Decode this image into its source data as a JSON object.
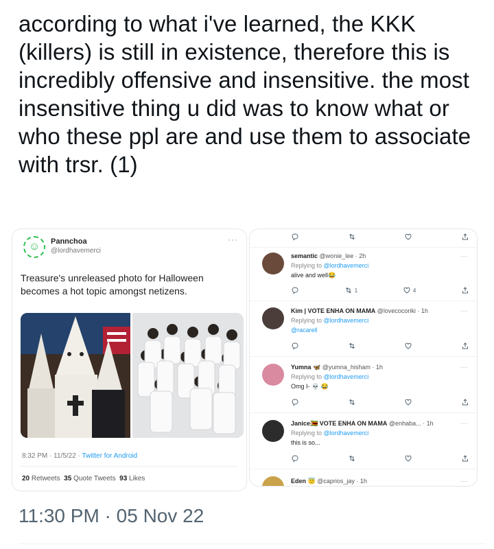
{
  "tweet": {
    "text": "according to what i've learned, the KKK (killers) is still in existence, therefore this is incredibly offensive and insensitive. the most insensitive thing u did was to know what or who these ppl are and use them to associate with trsr. (1)",
    "timestamp": "11:30 PM · 05 Nov 22"
  },
  "left_card": {
    "name": "Pannchoa",
    "handle": "@lordhavemerci",
    "more": "···",
    "text": "Treasure's unreleased photo for Halloween becomes a hot topic amongst netizens.",
    "meta_time": "8:32 PM · 11/5/22 · ",
    "meta_source": "Twitter for Android",
    "retweets_count": "20",
    "retweets_label": " Retweets",
    "quotes_count": "35",
    "quotes_label": " Quote Tweets",
    "likes_count": "93",
    "likes_label": " Likes"
  },
  "right_card": {
    "top_actions": {
      "retweets": "",
      "likes": ""
    },
    "replies": [
      {
        "name": "semantic",
        "handle": "@wonie_lee · 2h",
        "replying_prefix": "Replying to ",
        "replying_to": "@lordhavemerci",
        "body": "alive and well😂",
        "retweets": "1",
        "likes": "4",
        "more": "···"
      },
      {
        "name": "Kim | VOTE ENHA ON MAMA",
        "handle": "@lovecocoriki · 1h",
        "replying_prefix": "Replying to ",
        "replying_to": "@lordhavemerci",
        "body": "@racarell",
        "retweets": "",
        "likes": "",
        "more": "···"
      },
      {
        "name": "Yumna 🦋",
        "handle": "@yumna_hisham · 1h",
        "replying_prefix": "Replying to ",
        "replying_to": "@lordhavemerci",
        "body": "Omg I- 💀 😂",
        "retweets": "",
        "likes": "",
        "more": "···"
      },
      {
        "name": "Janice🇿🇼 VOTE ENHA ON MAMA",
        "handle": "@enhaba... · 1h",
        "replying_prefix": "Replying to ",
        "replying_to": "@lordhavemerci",
        "body": "this is so...",
        "retweets": "",
        "likes": "",
        "more": "···"
      },
      {
        "name": "Eden 😇",
        "handle": "@caprios_jay · 1h",
        "more": "···"
      }
    ]
  },
  "icons": [
    "reply-icon",
    "retweet-icon",
    "like-icon",
    "share-icon",
    "more-icon"
  ],
  "colors": {
    "link": "#1d9bf0",
    "text": "#0f1419",
    "muted": "#536471"
  }
}
